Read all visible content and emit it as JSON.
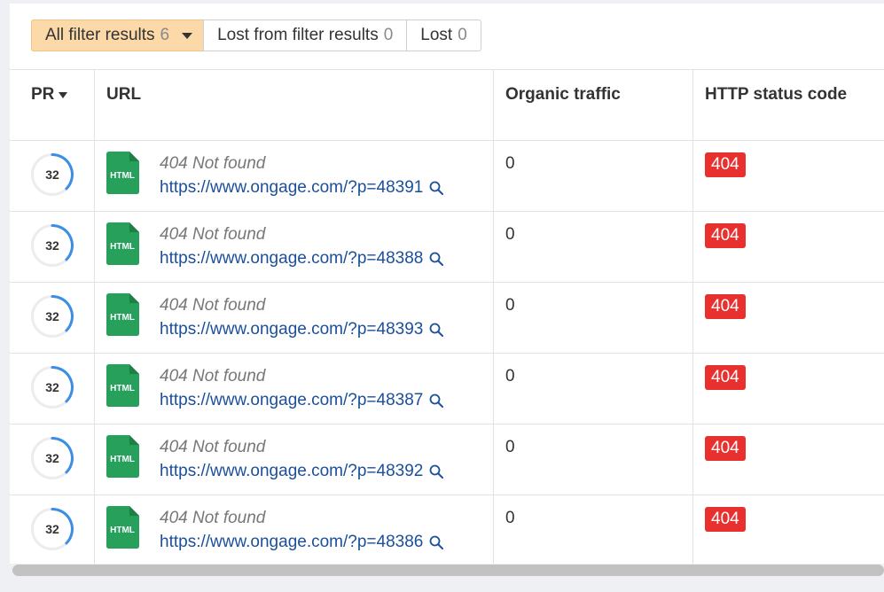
{
  "filters": [
    {
      "label": "All filter results",
      "count": "6",
      "active": true
    },
    {
      "label": "Lost from filter results",
      "count": "0",
      "active": false
    },
    {
      "label": "Lost",
      "count": "0",
      "active": false
    }
  ],
  "columns": {
    "pr": "PR",
    "url": "URL",
    "organic": "Organic traffic",
    "http": "HTTP status code"
  },
  "icon_label": "HTML",
  "rows": [
    {
      "pr": "32",
      "title": "404 Not found",
      "url": "https://www.ongage.com/?p=48391",
      "organic": "0",
      "status": "404"
    },
    {
      "pr": "32",
      "title": "404 Not found",
      "url": "https://www.ongage.com/?p=48388",
      "organic": "0",
      "status": "404"
    },
    {
      "pr": "32",
      "title": "404 Not found",
      "url": "https://www.ongage.com/?p=48393",
      "organic": "0",
      "status": "404"
    },
    {
      "pr": "32",
      "title": "404 Not found",
      "url": "https://www.ongage.com/?p=48387",
      "organic": "0",
      "status": "404"
    },
    {
      "pr": "32",
      "title": "404 Not found",
      "url": "https://www.ongage.com/?p=48392",
      "organic": "0",
      "status": "404"
    },
    {
      "pr": "32",
      "title": "404 Not found",
      "url": "https://www.ongage.com/?p=48386",
      "organic": "0",
      "status": "404"
    }
  ],
  "colors": {
    "active_tab": "#fbd9a9",
    "link": "#1a4f9c",
    "status_error": "#e8302f",
    "html_icon": "#27a05b",
    "pr_ring": "#3a8ee6"
  }
}
